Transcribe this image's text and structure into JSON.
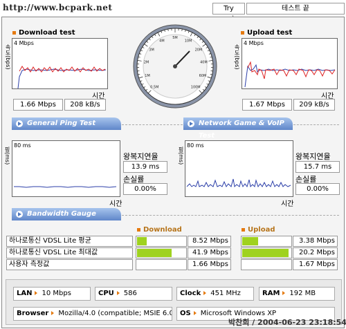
{
  "url": "http://www.bcpark.net",
  "try_again": "Try again",
  "test_status": "테스트 끝",
  "download": {
    "title": "Download test",
    "ymax": "4 Mbps",
    "yaxis": "속도(bps)",
    "xlabel": "시간",
    "mbps": "1.66 Mbps",
    "kbs": "208 kB/s"
  },
  "upload": {
    "title": "Upload test",
    "ymax": "4 Mbps",
    "yaxis": "속도(bps)",
    "xlabel": "시간",
    "mbps": "1.67 Mbps",
    "kbs": "209 kB/s"
  },
  "tabs": {
    "ping": "General Ping Test",
    "game": "Network Game & VoIP Test",
    "bandwidth": "Bandwidth Gauge"
  },
  "ping": {
    "ymax": "80 ms",
    "yaxis": "핑(ms)",
    "xlabel": "시간",
    "rtt_label": "왕복지연율",
    "rtt_value": "13.9 ms",
    "loss_label": "손실률",
    "loss_value": "0.00%"
  },
  "game": {
    "ymax": "80 ms",
    "yaxis": "핑(ms)",
    "xlabel": "시간",
    "rtt_label": "왕복지연율",
    "rtt_value": "15.7 ms",
    "loss_label": "손실률",
    "loss_value": "0.00%"
  },
  "gauge": {
    "ticks": [
      "0.5M",
      "1M",
      "2M",
      "3M",
      "4M",
      "5M",
      "10M",
      "20M",
      "40M",
      "60M",
      "100M"
    ],
    "needle_value": "1.66"
  },
  "bandwidth": {
    "download_header": "Download",
    "upload_header": "Upload",
    "rows": [
      {
        "label": "하나로통신 VDSL Lite 평균",
        "down": "8.52 Mbps",
        "down_frac": 0.2,
        "up": "3.38 Mbps",
        "up_frac": 0.33
      },
      {
        "label": "하나로통신 VDSL Lite 최대값",
        "down": "41.9 Mbps",
        "down_frac": 0.72,
        "up": "20.2 Mbps",
        "up_frac": 0.95
      },
      {
        "label": "사용자 측정값",
        "down": "1.66 Mbps",
        "down_frac": 0.0,
        "up": "1.67 Mbps",
        "up_frac": 0.0
      }
    ]
  },
  "system": {
    "lan_label": "LAN",
    "lan_value": "10 Mbps",
    "cpu_label": "CPU",
    "cpu_value": "586",
    "clock_label": "Clock",
    "clock_value": "451 MHz",
    "ram_label": "RAM",
    "ram_value": "192 MB",
    "browser_label": "Browser",
    "browser_value": "Mozilla/4.0 (compatible; MSIE 6.0",
    "os_label": "OS",
    "os_value": "Microsoft Windows XP"
  },
  "watermark": "박찬희 / 2004-06-23 23:18:54"
}
